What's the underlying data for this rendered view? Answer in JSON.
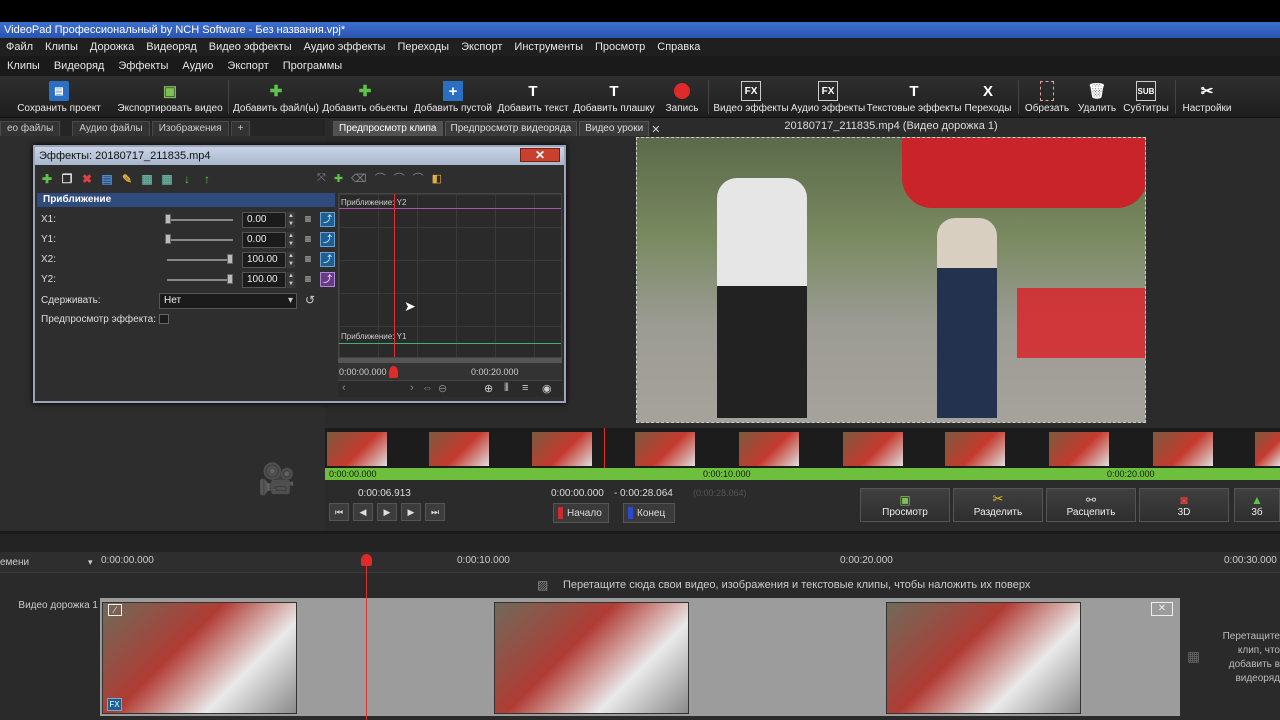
{
  "window": {
    "title": "VideoPad Профессиональный by NCH Software - Без названия.vpj*"
  },
  "menu": [
    "Файл",
    "Клипы",
    "Дорожка",
    "Видеоряд",
    "Видео эффекты",
    "Аудио эффекты",
    "Переходы",
    "Экспорт",
    "Инструменты",
    "Просмотр",
    "Справка"
  ],
  "tabs": [
    "Клипы",
    "Видеоряд",
    "Эффекты",
    "Аудио",
    "Экспорт",
    "Программы"
  ],
  "toolbar": [
    {
      "label": "Сохранить проект",
      "icon": "save-icon"
    },
    {
      "label": "Экспортировать видео",
      "icon": "export-video-icon"
    },
    {
      "label": "Добавить файл(ы)",
      "icon": "add-files-icon"
    },
    {
      "label": "Добавить обьекты",
      "icon": "add-objects-icon"
    },
    {
      "label": "Добавить пустой",
      "icon": "add-blank-icon"
    },
    {
      "label": "Добавить текст",
      "icon": "add-text-icon"
    },
    {
      "label": "Добавить плашку",
      "icon": "add-plate-icon"
    },
    {
      "label": "Запись",
      "icon": "record-icon"
    },
    {
      "label": "Видео эффекты",
      "icon": "video-effects-icon"
    },
    {
      "label": "Аудио эффекты",
      "icon": "audio-effects-icon"
    },
    {
      "label": "Текстовые эффекты",
      "icon": "text-effects-icon"
    },
    {
      "label": "Переходы",
      "icon": "transitions-icon"
    },
    {
      "label": "Обрезать",
      "icon": "crop-icon"
    },
    {
      "label": "Удалить",
      "icon": "trash-icon"
    },
    {
      "label": "Субтитры",
      "icon": "subtitles-icon"
    },
    {
      "label": "Настройки",
      "icon": "settings-icon"
    }
  ],
  "left_tabs": [
    "ео файлы",
    "Аудио файлы",
    "Изображения",
    "+"
  ],
  "preview_tabs": [
    "Предпросмотр клипа",
    "Предпросмотр видеоряда",
    "Видео уроки"
  ],
  "clip_title": "20180717_211835.mp4 (Видео дорожка 1)",
  "dialog": {
    "title": "Эффекты: 20180717_211835.mp4",
    "close": "✕",
    "section": "Приближение",
    "params": [
      {
        "label": "X1:",
        "value": "0.00"
      },
      {
        "label": "Y1:",
        "value": "0.00"
      },
      {
        "label": "X2:",
        "value": "100.00"
      },
      {
        "label": "Y2:",
        "value": "100.00"
      }
    ],
    "hold_label": "Сдерживать:",
    "hold_value": "Нет",
    "preview_label": "Предпросмотр эффекта:",
    "graph_top": "Приближение: Y2",
    "graph_bottom": "Приближение: Y1",
    "graph_t0": "0:00:00.000",
    "graph_t1": "0:00:20.000"
  },
  "strip": {
    "t0": "0:00:00.000",
    "t1": "0:00:10.000",
    "t2": "0:00:20.000"
  },
  "clip_controls": {
    "current": "0:00:06.913",
    "start": "0:00:00.000",
    "end": "0:00:28.064",
    "dim": "(0:00:28.064)",
    "start_btn": "Начало",
    "end_btn": "Конец"
  },
  "big_buttons": [
    "Просмотр",
    "Разделить",
    "Расцепить",
    "3D",
    "3б"
  ],
  "timeline": {
    "scale_label": "емени",
    "t0": "0:00:00.000",
    "t1": "0:00:10.000",
    "t2": "0:00:20.000",
    "t3": "0:00:30.000",
    "overlay_hint": "Перетащите сюда свои видео, изображения и текстовые клипы, чтобы наложить их поверх",
    "track_label": "Видео дорожка 1",
    "side_hint": "Перетащите клип, что добавить в видеоряд",
    "fx_badge": "FX"
  }
}
